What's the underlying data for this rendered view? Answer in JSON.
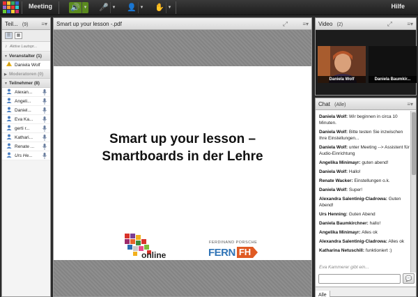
{
  "topbar": {
    "menu_meeting": "Meeting",
    "menu_help": "Hilfe",
    "accent": "#5a8a1e"
  },
  "attendees": {
    "title": "Teil...",
    "count": "(9)",
    "status_text": "Aktive Lautspr...",
    "roles": [
      {
        "label": "Veranstalter (1)",
        "people": [
          "Daniela Wolf"
        ]
      },
      {
        "label": "Moderatoren (0)",
        "people": []
      },
      {
        "label": "Teilnehmer (8)",
        "people": [
          "Alexan...",
          "Angeli...",
          "Daniel...",
          "Eva Ka...",
          "gerti r...",
          "Kathari...",
          "Renate ...",
          "Urs He..."
        ]
      }
    ]
  },
  "presentation": {
    "title": "Smart up your lesson -.pdf",
    "slide_title_line1": "Smart up your lesson –",
    "slide_title_line2": "Smartboards in der Lehre",
    "logo_online": "online",
    "logo_ferdinand": "FERDINAND PORSCHE",
    "logo_fern": "FERN",
    "logo_fh": "FH"
  },
  "video": {
    "title": "Video",
    "count": "(2)",
    "tiles": [
      "Daniela Wolf",
      "Daniela Baumkir..."
    ]
  },
  "chat": {
    "title": "Chat",
    "scope": "(Alle)",
    "messages": [
      {
        "author": "Daniela Wolf:",
        "text": "Wir beginnen in circa 10 Minuten."
      },
      {
        "author": "Daniela Wolf:",
        "text": "Bitte testen Sie inzwischen Ihre Einstellungen..."
      },
      {
        "author": "Daniela Wolf:",
        "text": "unter Meeting --> Assistent für Audio-Einrichtung"
      },
      {
        "author": "Angelika Minimayr:",
        "text": "guten abend!"
      },
      {
        "author": "Daniela Wolf:",
        "text": "Hallo!"
      },
      {
        "author": "Renate Wacker:",
        "text": "Einstellungen o.k."
      },
      {
        "author": "Daniela Wolf:",
        "text": "Super!"
      },
      {
        "author": "Alexandra Salentinig-Cladrowa:",
        "text": "Guten Abend!"
      },
      {
        "author": "Urs Henning:",
        "text": "Guten Abend"
      },
      {
        "author": "Daniela Baumkirchner:",
        "text": "hallo!"
      },
      {
        "author": "Angelika Minimayr:",
        "text": "Alles ok"
      },
      {
        "author": "Alexandra Salentinig-Cladrowa:",
        "text": "Alles ok"
      },
      {
        "author": "Katharina Netuschill:",
        "text": "funktioniert :)"
      }
    ],
    "typing": "Eva Kammerer gibt ein...",
    "input_placeholder": "",
    "tab_label": "Alle"
  }
}
